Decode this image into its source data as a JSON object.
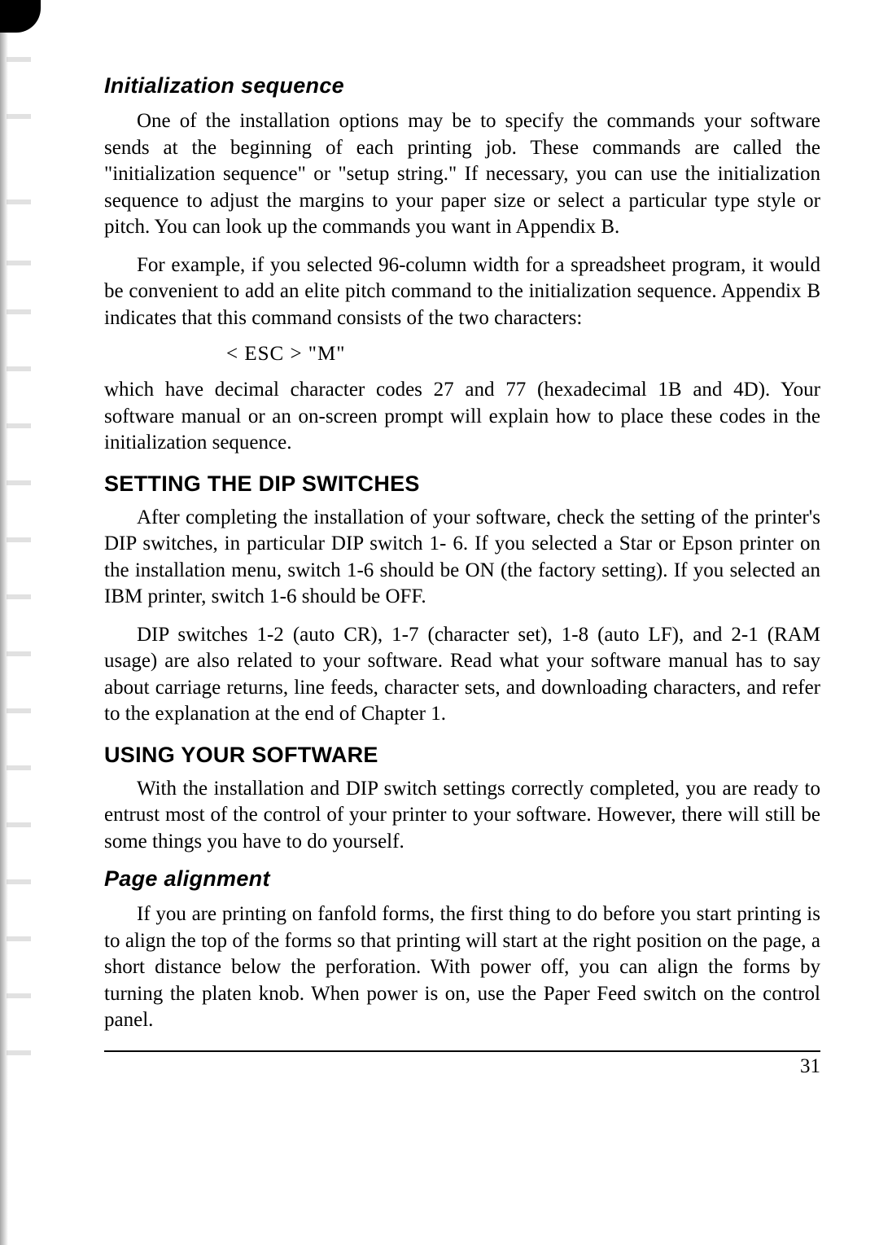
{
  "headings": {
    "init_sequence": "Initialization sequence",
    "setting_dip": "SETTING THE DIP SWITCHES",
    "using_software": "USING YOUR SOFTWARE",
    "page_alignment": "Page alignment"
  },
  "paragraphs": {
    "p1": "One of the installation options may be to specify the commands your software sends at the beginning of each printing job. These commands are called the \"initialization sequence\" or \"setup string.\" If necessary, you can use the initialization sequence to adjust the margins to your paper size or select a particular type style or pitch. You can look up the commands you want in Appendix B.",
    "p2": "For example, if you selected 96-column width for a spreadsheet program, it would be convenient to add an elite pitch command to the initialization sequence. Appendix B indicates that this command consists of the two characters:",
    "code": "< ESC >   \"M\"",
    "p3": "which have decimal character codes 27 and 77 (hexadecimal 1B and 4D). Your software manual or an on-screen prompt will explain how to place these codes in the initialization sequence.",
    "p4": "After completing the installation of your software, check the setting of the printer's DIP switches, in particular DIP switch 1- 6. If you selected a Star or Epson printer on the installation menu, switch 1-6 should be ON (the factory setting). If you selected an IBM printer, switch 1-6 should be OFF.",
    "p5": "DIP switches 1-2 (auto CR), 1-7 (character set), 1-8 (auto LF), and 2-1 (RAM usage) are also related to your software. Read what your software manual has to say about carriage returns, line feeds, character sets, and downloading characters, and refer to the explanation at the end of Chapter 1.",
    "p6": "With the installation and DIP switch settings correctly completed, you are ready to entrust most of the control of your printer to your software. However, there will still be some things you have to do yourself.",
    "p7": "If you are printing on fanfold forms, the first thing to do before you start printing is to align the top of the forms so that printing will start at the right position on the page, a short distance below the perforation. With power off, you can align the forms by turning the platen knob. When power is on, use the Paper Feed switch on the control panel."
  },
  "page_number": "31"
}
